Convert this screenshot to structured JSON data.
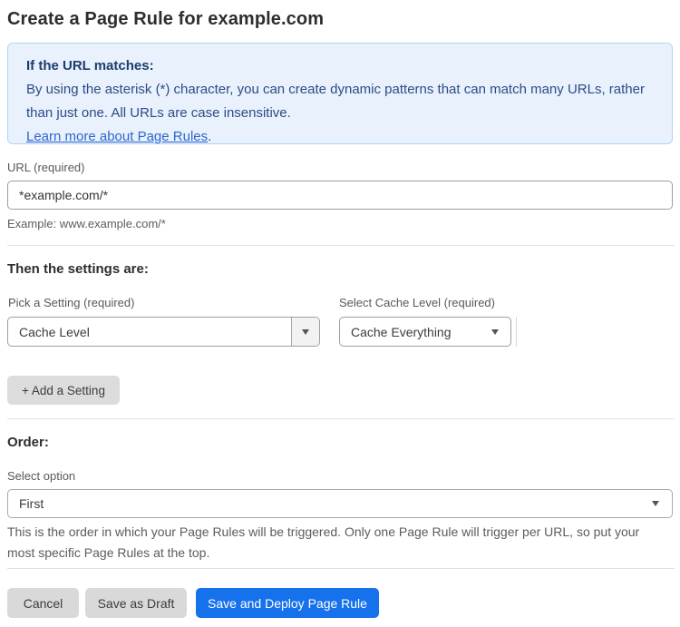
{
  "page_title": "Create a Page Rule for example.com",
  "info_box": {
    "heading": "If the URL matches:",
    "body": "By using the asterisk (*) character, you can create dynamic patterns that can match many URLs, rather than just one. All URLs are case insensitive.",
    "link_label": "Learn more about Page Rules",
    "link_suffix": "."
  },
  "url_field": {
    "label": "URL (required)",
    "value": "*example.com/*",
    "helper": "Example: www.example.com/*"
  },
  "settings_section": {
    "heading": "Then the settings are:",
    "setting_label": "Pick a Setting (required)",
    "setting_value": "Cache Level",
    "cache_label": "Select Cache Level (required)",
    "cache_value": "Cache Everything",
    "add_setting_label": "+ Add a Setting"
  },
  "order_section": {
    "heading": "Order:",
    "select_label": "Select option",
    "select_value": "First",
    "helper": "This is the order in which your Page Rules will be triggered. Only one Page Rule will trigger per URL, so put your most specific Page Rules at the top."
  },
  "footer": {
    "cancel_label": "Cancel",
    "save_draft_label": "Save as Draft",
    "save_deploy_label": "Save and Deploy Page Rule"
  },
  "colors": {
    "accent_blue": "#1672ec",
    "info_background": "#e8f1fc",
    "info_border": "#b5d3f4",
    "info_text": "#2d4b87",
    "link_blue": "#2f65d0"
  }
}
